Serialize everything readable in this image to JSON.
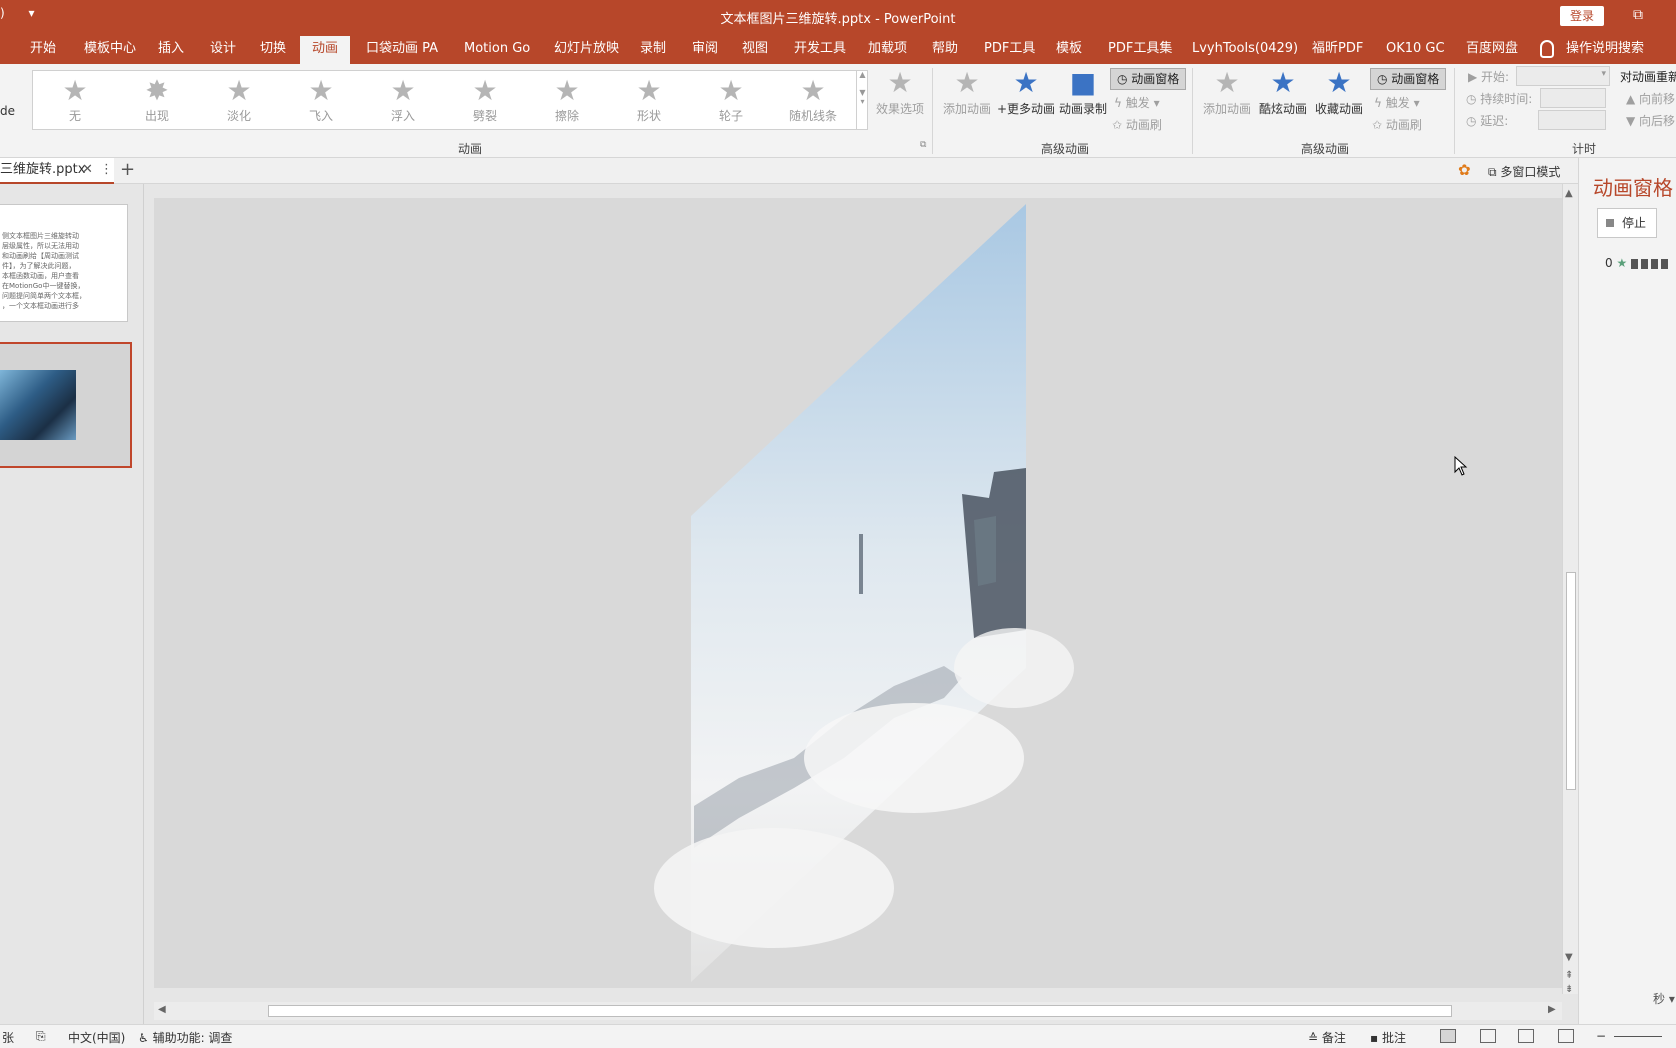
{
  "titlebar": {
    "qat_left": ")",
    "qat_arrow": "▾",
    "title": "文本框图片三维旋转.pptx  -  PowerPoint",
    "login": "登录",
    "window_btn": "⧉"
  },
  "tabs": [
    {
      "label": "开始"
    },
    {
      "label": "模板中心"
    },
    {
      "label": "插入"
    },
    {
      "label": "设计"
    },
    {
      "label": "切换"
    },
    {
      "label": "动画"
    },
    {
      "label": "口袋动画 PA"
    },
    {
      "label": "Motion Go"
    },
    {
      "label": "幻灯片放映"
    },
    {
      "label": "录制"
    },
    {
      "label": "审阅"
    },
    {
      "label": "视图"
    },
    {
      "label": "开发工具"
    },
    {
      "label": "加载项"
    },
    {
      "label": "帮助"
    },
    {
      "label": "PDF工具"
    },
    {
      "label": "模板"
    },
    {
      "label": "PDF工具集"
    },
    {
      "label": "LvyhTools(0429)"
    },
    {
      "label": "福昕PDF"
    },
    {
      "label": "OK10 GC"
    },
    {
      "label": "百度网盘"
    },
    {
      "label": "操作说明搜索"
    }
  ],
  "ribbon": {
    "left_cut": "de",
    "gallery": [
      "无",
      "出现",
      "淡化",
      "飞入",
      "浮入",
      "劈裂",
      "擦除",
      "形状",
      "轮子",
      "随机线条"
    ],
    "effect_options": "效果选项",
    "group_animation": "动画",
    "add_animation": "添加动画",
    "more_animation": "+更多动画",
    "animation_record": "动画录制",
    "animation_pane": "动画窗格",
    "trigger": "触发",
    "animation_painter": "动画刷",
    "group_advanced": "高级动画",
    "add_animation2": "添加动画",
    "cool_animation": "酷炫动画",
    "fav_animation": "收藏动画",
    "animation_pane2": "动画窗格",
    "trigger2": "触发",
    "animation_painter2": "动画刷",
    "group_advanced2": "高级动画",
    "start": "开始:",
    "duration": "持续时间:",
    "delay": "延迟:",
    "reorder": "对动画重新",
    "move_earlier": "向前移",
    "move_later": "向后移",
    "group_timing": "计时"
  },
  "doctab": {
    "name": "三维旋转.pptx",
    "close": "✕",
    "more": "⋮",
    "add": "+",
    "multi_window": "多窗口模式"
  },
  "thumbnail_text_lines": [
    "侧文本框图片三维旋转动",
    "层级属性，所以无法用动",
    "和动画刷给【周动画测试",
    "件】，为了解决此问题，",
    "本框函数动画，用户查看",
    "在MotionGo中一键替换，",
    "问题提问简单两个文本框，",
    "，一个文本框动画进行多"
  ],
  "right_pane": {
    "title": "动画窗格",
    "stop": "停止",
    "item_index": "0",
    "seconds": "秒 ▾"
  },
  "statusbar": {
    "slide": "张",
    "language": "中文(中国)",
    "accessibility": "辅助功能: 调查",
    "notes": "备注",
    "comments": "批注"
  },
  "colors": {
    "accent": "#b7472a",
    "ribbon_bg": "#f3f3f3",
    "canvas_bg": "#d9d9d9"
  }
}
